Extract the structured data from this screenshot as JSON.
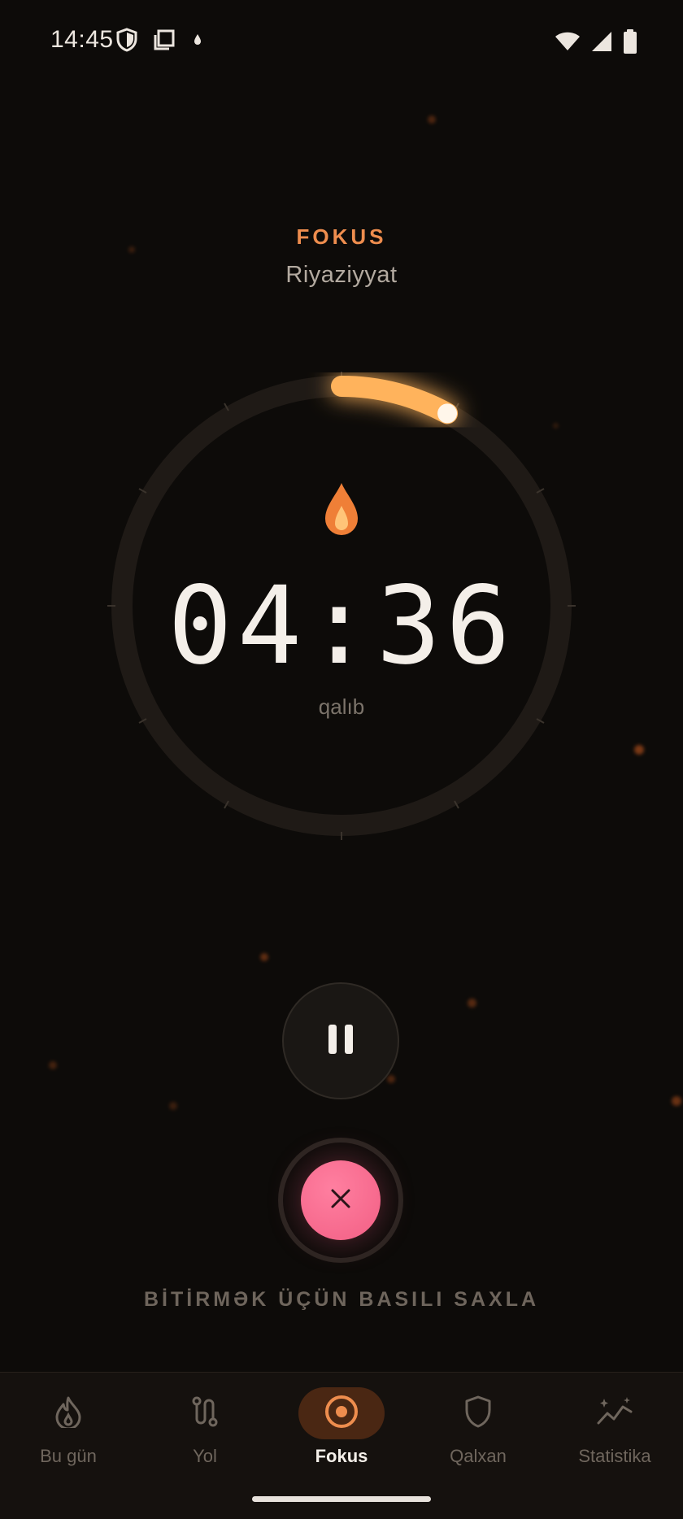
{
  "status_bar": {
    "time": "14:45",
    "left_icons": [
      "shield-icon",
      "screenshot-icon",
      "drop-icon"
    ],
    "right_icons": [
      "wifi-icon",
      "signal-icon",
      "battery-icon"
    ]
  },
  "header": {
    "mode": "FOKUS",
    "subject": "Riyaziyyat"
  },
  "timer": {
    "time": "04:36",
    "caption": "qalıb",
    "progress_fraction": 0.08,
    "center_icon": "flame-icon"
  },
  "controls": {
    "pause_icon": "pause-icon",
    "stop_icon": "close-icon",
    "hold_hint": "BİTİRMƏK ÜÇÜN BASILI SAXLA"
  },
  "nav": {
    "items": [
      {
        "label": "Bu gün",
        "icon": "flame-outline-icon",
        "active": false
      },
      {
        "label": "Yol",
        "icon": "route-icon",
        "active": false
      },
      {
        "label": "Fokus",
        "icon": "target-icon",
        "active": true
      },
      {
        "label": "Qalxan",
        "icon": "shield-outline-icon",
        "active": false
      },
      {
        "label": "Statistika",
        "icon": "chart-sparkle-icon",
        "active": false
      }
    ]
  },
  "colors": {
    "background": "#0d0b09",
    "accent": "#ee8d4e",
    "arc": "#ffb35c",
    "stop": "#f25f84",
    "nav_active_bg": "#4a2713"
  }
}
